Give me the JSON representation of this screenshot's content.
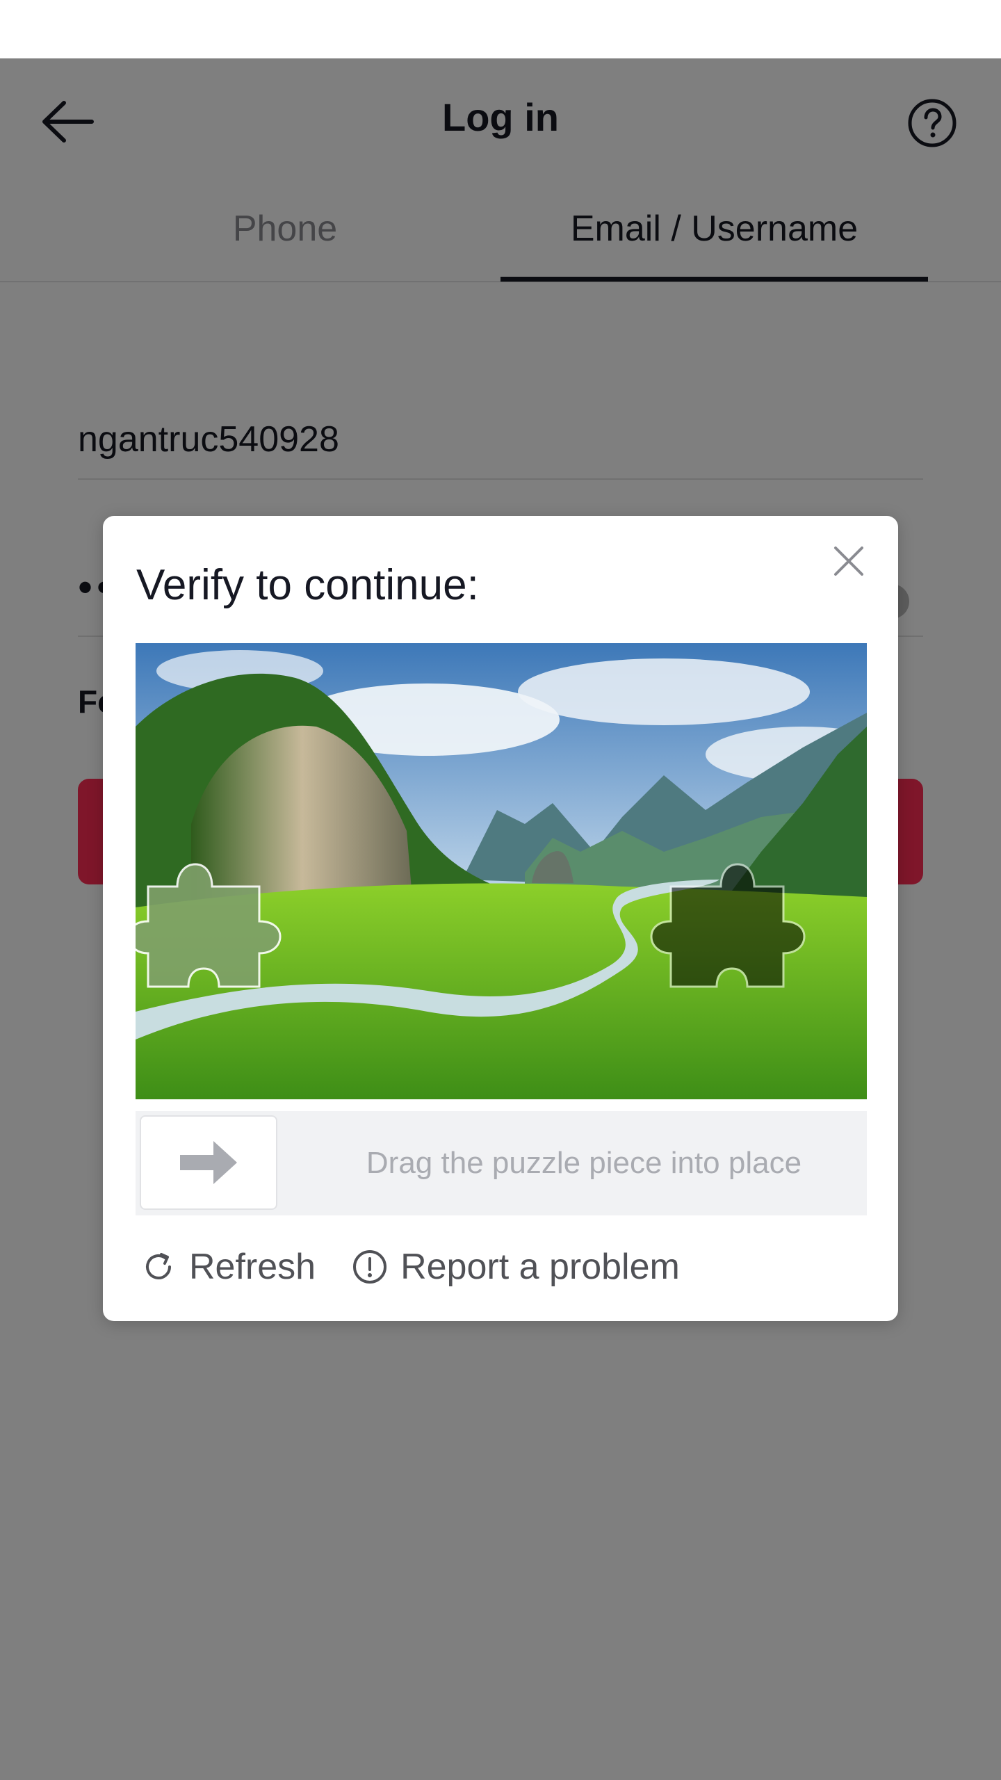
{
  "header": {
    "title": "Log in",
    "back_icon": "arrow-left-icon",
    "help_icon": "question-circle-icon"
  },
  "tabs": [
    {
      "label": "Phone",
      "selected": false
    },
    {
      "label": "Email / Username",
      "selected": true
    }
  ],
  "form": {
    "username_value": "ngantruc540928",
    "password_value": "••",
    "forgot_partial": "Fo"
  },
  "captcha": {
    "title": "Verify to continue:",
    "close_icon": "close-icon",
    "slider_hint": "Drag the puzzle piece into place",
    "slider_icon": "arrow-right-icon",
    "actions": [
      {
        "label": "Refresh",
        "icon": "refresh-icon"
      },
      {
        "label": "Report a problem",
        "icon": "exclamation-circle-icon"
      }
    ]
  },
  "colors": {
    "accent": "#fe2c55",
    "text": "#161823",
    "muted": "#8a8b91",
    "overlay": "rgba(0,0,0,0.5)"
  }
}
